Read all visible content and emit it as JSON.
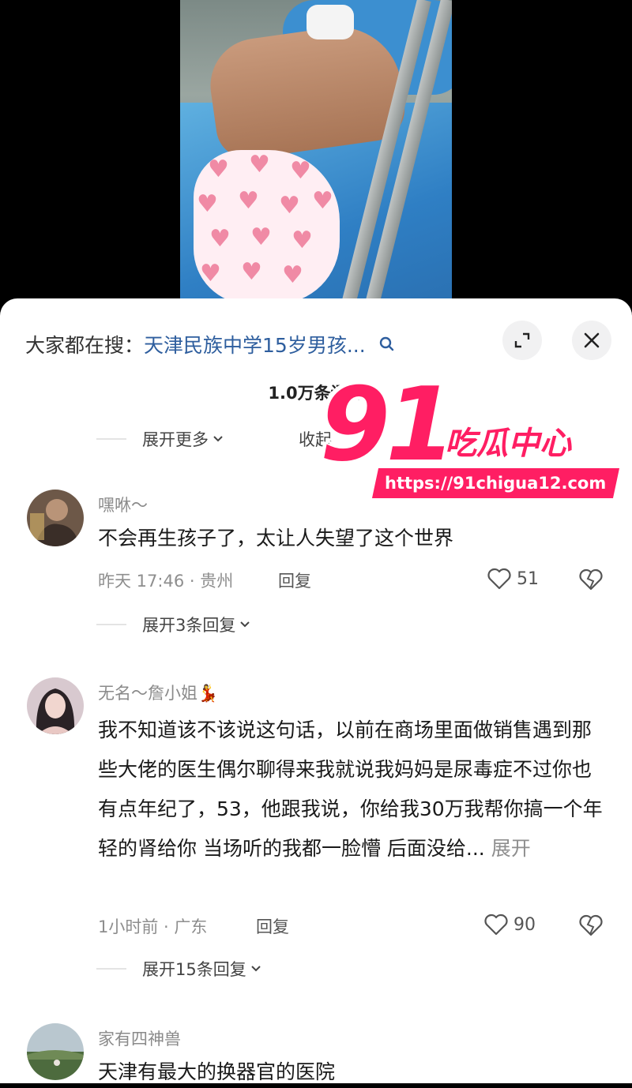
{
  "header": {
    "search_prefix": "大家都在搜：",
    "search_term": "天津民族中学15岁男孩...",
    "comment_count": "1.0万条评论",
    "expand_more": "展开更多",
    "collapse": "收起"
  },
  "watermark": {
    "number": "91",
    "name": "吃瓜中心",
    "url": "https://91chigua12.com"
  },
  "comments": [
    {
      "user": "嘿咻～",
      "text": "不会再生孩子了，太让人失望了这个世界",
      "meta": "昨天 17:46 · 贵州",
      "reply": "回复",
      "likes": "51",
      "expand": "展开3条回复"
    },
    {
      "user": "无名～詹小姐💃",
      "text": "我不知道该不该说这句话，以前在商场里面做销售遇到那些大佬的医生偶尔聊得来我就说我妈妈是尿毒症不过你也有点年纪了，53，他跟我说，你给我30万我帮你搞一个年轻的肾给你 当场听的我都一脸懵 后面没给...",
      "more": "展开",
      "meta": "1小时前 · 广东",
      "reply": "回复",
      "likes": "90",
      "expand": "展开15条回复"
    },
    {
      "user": "家有四神兽",
      "text": "天津有最大的换器官的医院"
    }
  ],
  "icons": {
    "search": "search-icon",
    "expand": "expand-icon",
    "close": "close-icon",
    "like": "heart-outline-icon",
    "dislike": "broken-heart-icon",
    "chevron": "chevron-down-icon"
  },
  "colors": {
    "link_blue": "#2e5e9e",
    "watermark_pink": "#ff1e63",
    "text_gray": "#8e8e8e"
  }
}
